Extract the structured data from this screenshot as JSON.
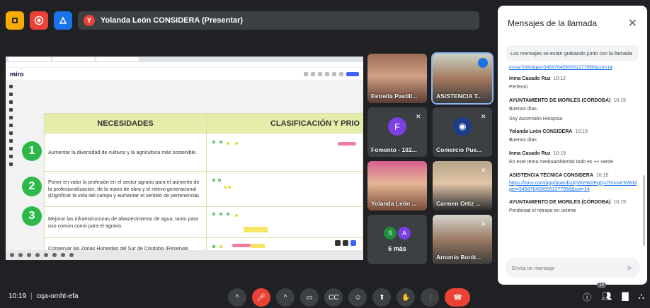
{
  "presenter": {
    "initial": "Y",
    "label": "Yolanda León CONSIDERA (Presentar)"
  },
  "board": {
    "app": "miro",
    "header_need": "NECESIDADES",
    "header_class": "CLASIFICACIÓN Y PRIO",
    "rows": [
      {
        "num": "1",
        "text": "Aumentar la diversidad de cultivos y la agricultura más sostenible."
      },
      {
        "num": "2",
        "text": "Poner en valor la profesión en el sector agrario para el aumento de la profesionalización, de la mano de obra y el relevo generacional (Dignificar la vida del campo y aumentar el sentido de pertenencia)."
      },
      {
        "num": "3",
        "text": "Mejorar las infraestructuras de abastecimiento de agua, tanto para uso común como para el agrario."
      },
      {
        "num": "",
        "text": "Conservar las Zonas Húmedas del Sur de Córdoba (Reservas"
      }
    ]
  },
  "participants": [
    {
      "name": "Estrella Pastill..."
    },
    {
      "name": "ASISTENCIA T..."
    },
    {
      "name": "Fomento - 102...",
      "initial": "F"
    },
    {
      "name": "Comercio Pue..."
    },
    {
      "name": "Yolanda León ..."
    },
    {
      "name": "Carmen Ortiz ..."
    },
    {
      "name": "6 más",
      "initials": [
        "S",
        "A"
      ]
    },
    {
      "name": "Antonio Bonit..."
    }
  ],
  "chat": {
    "title": "Mensajes de la llamada",
    "notice": "Los mensajes se están grabando junto con la llamada",
    "cut_link": "moveToWidget=3458764590051277958&cot=14",
    "messages": [
      {
        "who": "Inma Casado Ruz",
        "time": "10:12",
        "lines": [
          "Perfecto"
        ]
      },
      {
        "who": "AYUNTAMIENTO DE MORILES (CÓRDOBA)",
        "time": "10:19",
        "lines": [
          "Buenos días.",
          "Soy Ascensión Hinojosa"
        ]
      },
      {
        "who": "Yolanda León CONSIDERA",
        "time": "10:19",
        "lines": [
          "Buenos días"
        ]
      },
      {
        "who": "Inma Casado Ruz",
        "time": "10:19",
        "lines": [
          "En este tema medioambiental todo es ++ verde"
        ]
      },
      {
        "who": "ASISTENCIA TÉCNICA CONSIDERA",
        "time": "10:19",
        "link": "https://miro.com/app/board/uXjVKFW2EqQ=/?moveToWidget=3458764590051277958&cot=14"
      },
      {
        "who": "AYUNTAMIENTO DE MORILES (CÓRDOBA)",
        "time": "10:19",
        "lines": [
          "Perdonad el retraso en unirme"
        ]
      }
    ],
    "input_placeholder": "Envía un mensaje"
  },
  "bottom": {
    "time": "10:19",
    "separator": "|",
    "meeting_code": "cqa-omht-efa",
    "people_count": "14"
  },
  "colors": {
    "accent": "#1a73e8",
    "danger": "#ea4335",
    "bg": "#202124",
    "green_marker": "#2fb84a"
  }
}
